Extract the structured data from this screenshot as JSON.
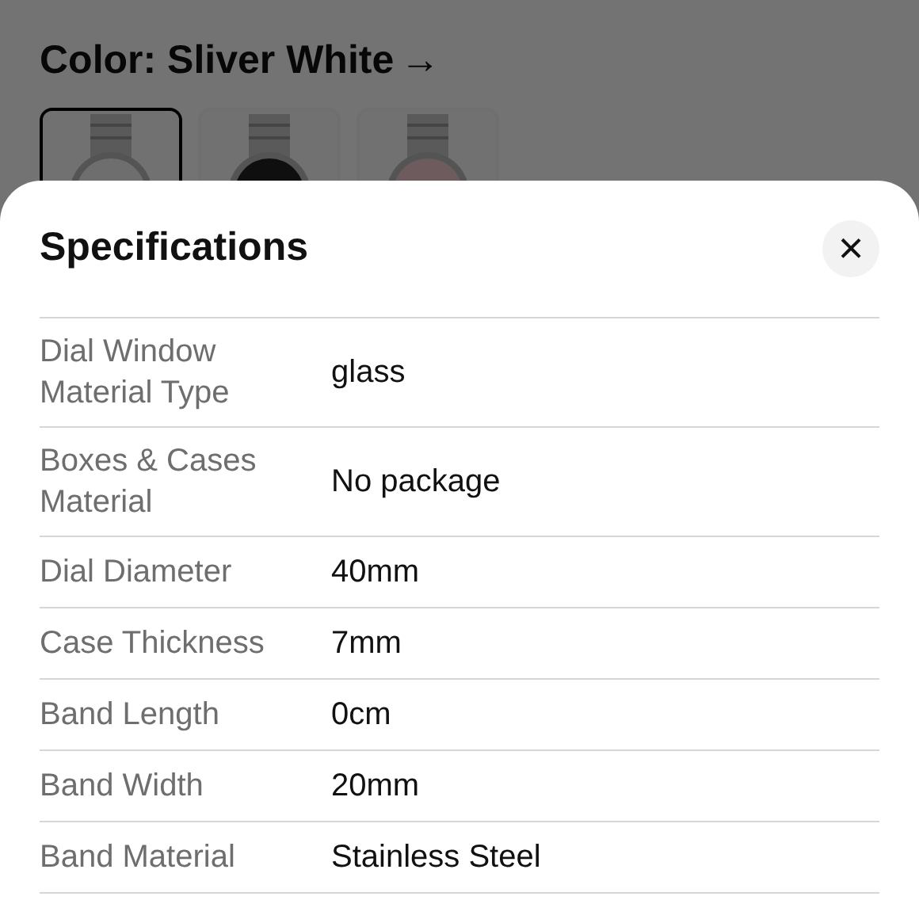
{
  "product": {
    "color_heading": "Color: Sliver White",
    "arrow": "→",
    "color_options": [
      {
        "kind": "picture",
        "selected": true
      },
      {
        "kind": "picture",
        "selected": false
      },
      {
        "kind": "picture",
        "selected": false
      }
    ]
  },
  "sheet": {
    "title": "Specifications",
    "close": "×",
    "rows": [
      {
        "label": "Dial Window Material Type",
        "value": "glass"
      },
      {
        "label": "Boxes & Cases Material",
        "value": "No package"
      },
      {
        "label": "Dial Diameter",
        "value": "40mm"
      },
      {
        "label": "Case Thickness",
        "value": "7mm"
      },
      {
        "label": "Band Length",
        "value": "0cm"
      },
      {
        "label": "Band Width",
        "value": "20mm"
      },
      {
        "label": "Band Material",
        "value": "Stainless Steel"
      }
    ]
  }
}
